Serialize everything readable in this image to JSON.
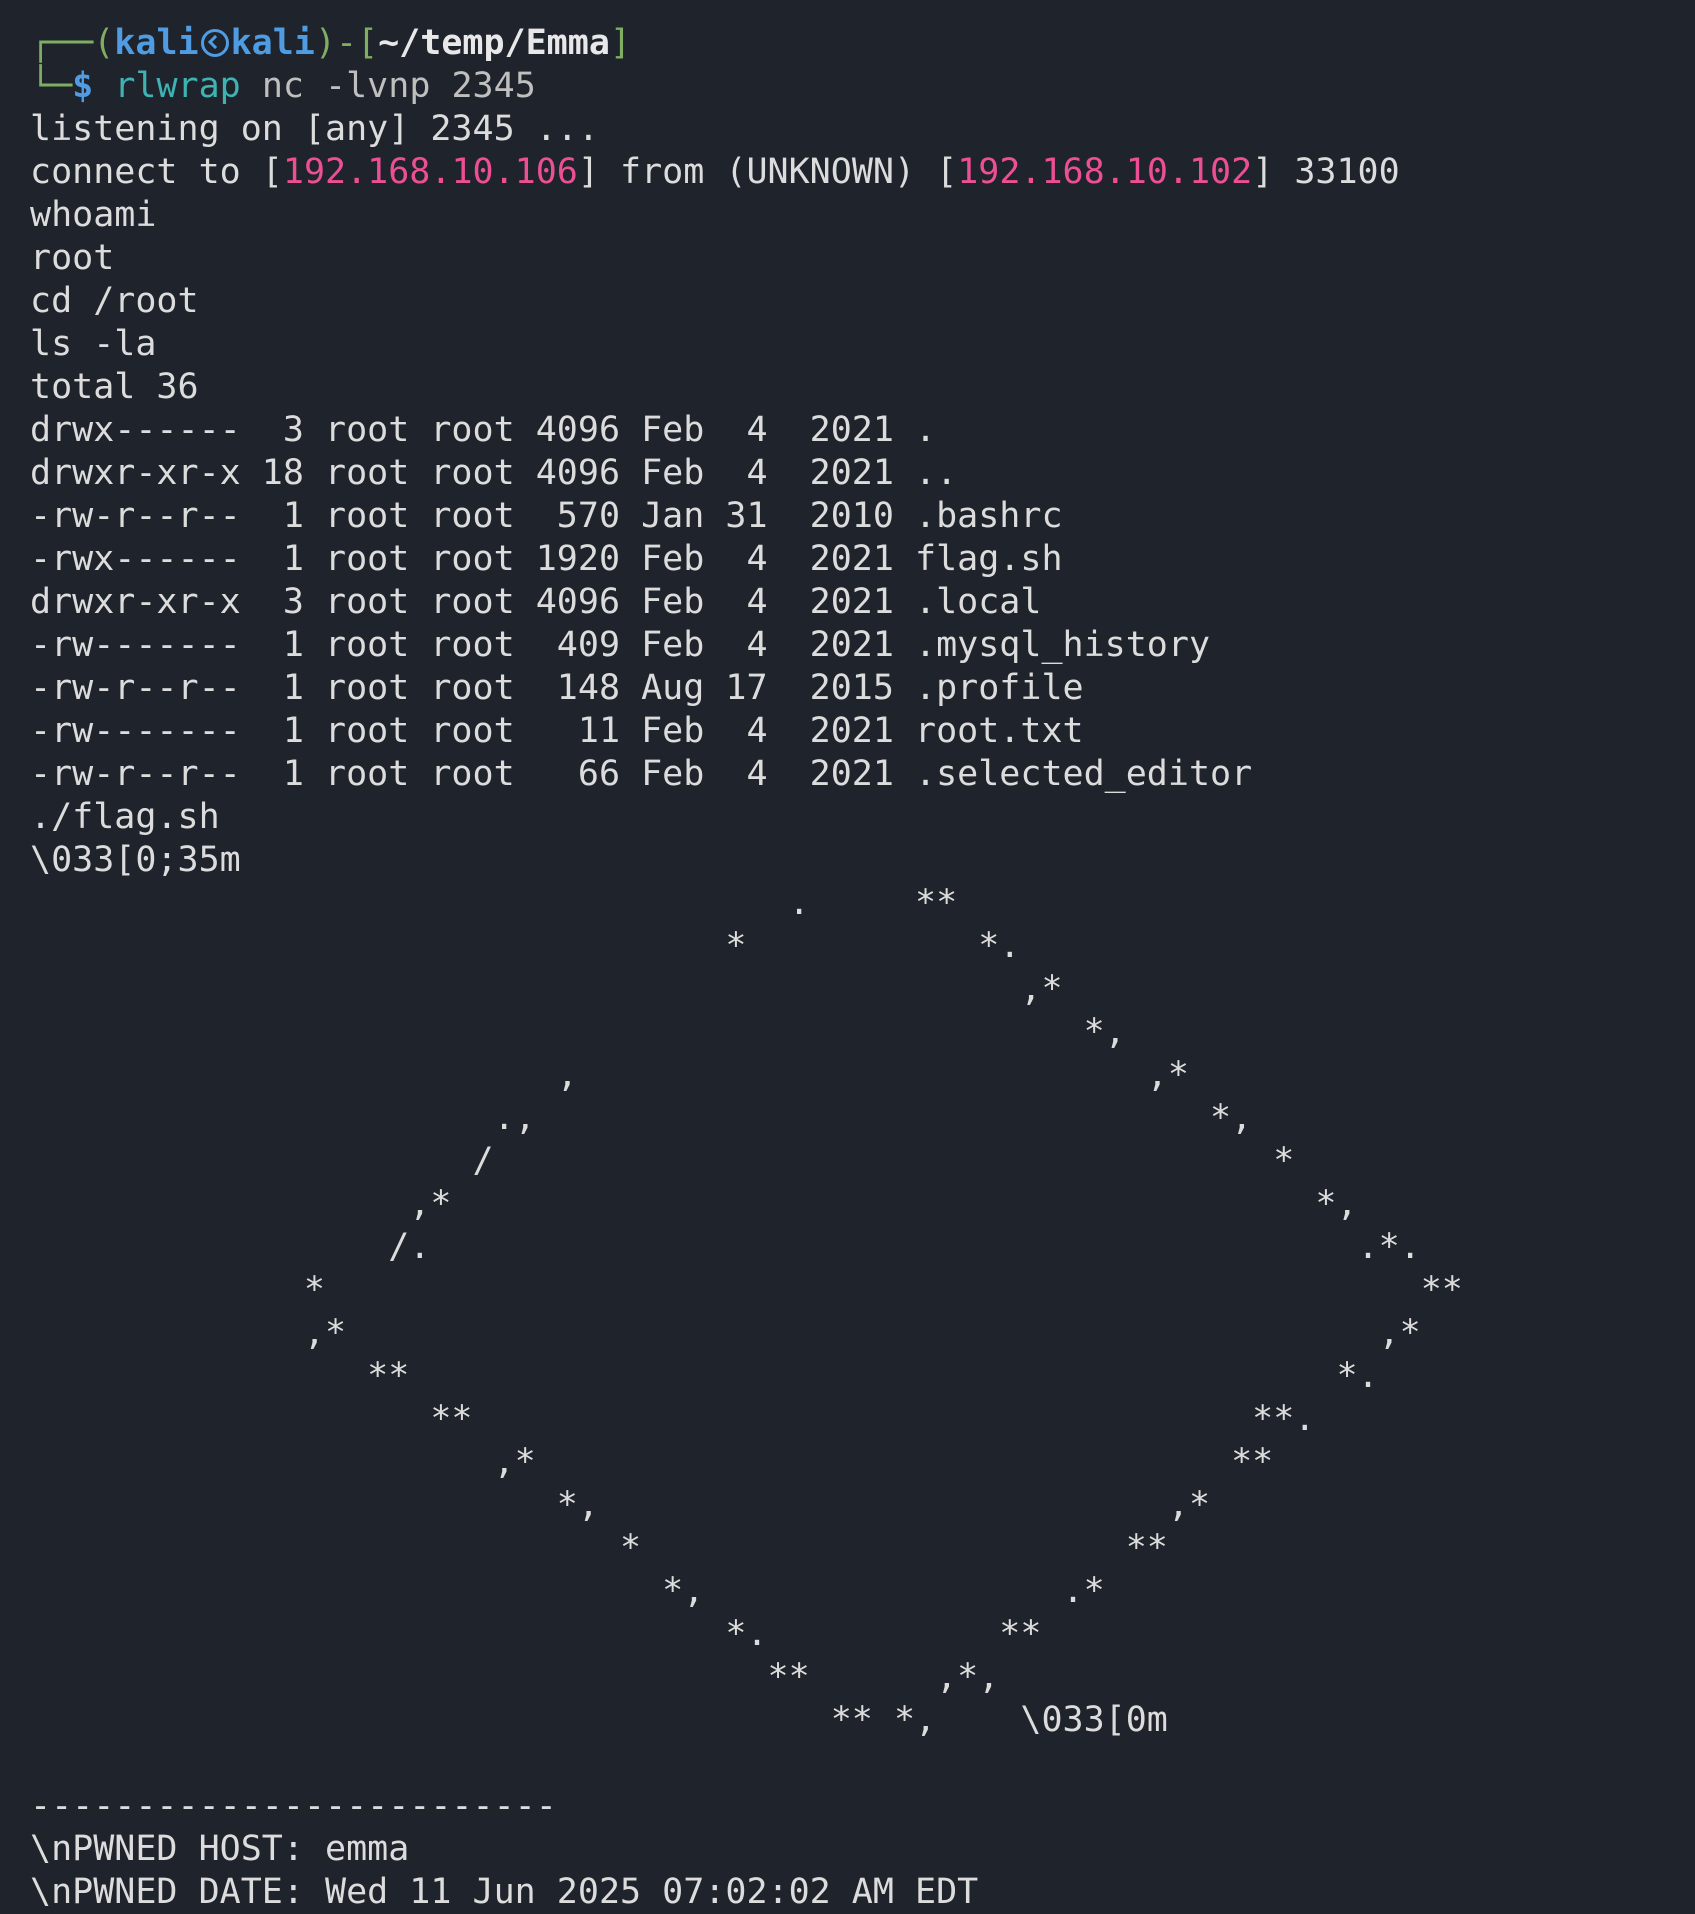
{
  "prompt": {
    "corner_top": "┌──",
    "open_paren": "(",
    "user": "kali",
    "host": "kali",
    "close_bracket_dash": ")-[",
    "path": "~/temp/Emma",
    "close_bracket": "]",
    "corner_bottom": "└─",
    "dollar": "$",
    "command": "rlwrap",
    "args": "nc -lvnp 2345"
  },
  "listening": "listening on [any] 2345 ...",
  "connect": {
    "prefix": "connect to [",
    "local_ip": "192.168.10.106",
    "mid": "] from (UNKNOWN) [",
    "remote_ip": "192.168.10.102",
    "suffix": "] 33100"
  },
  "output_lines": [
    "whoami",
    "root",
    "cd /root",
    "ls -la",
    "total 36",
    "drwx------  3 root root 4096 Feb  4  2021 .",
    "drwxr-xr-x 18 root root 4096 Feb  4  2021 ..",
    "-rw-r--r--  1 root root  570 Jan 31  2010 .bashrc",
    "-rwx------  1 root root 1920 Feb  4  2021 flag.sh",
    "drwxr-xr-x  3 root root 4096 Feb  4  2021 .local",
    "-rw-------  1 root root  409 Feb  4  2021 .mysql_history",
    "-rw-r--r--  1 root root  148 Aug 17  2015 .profile",
    "-rw-------  1 root root   11 Feb  4  2021 root.txt",
    "-rw-r--r--  1 root root   66 Feb  4  2021 .selected_editor",
    "./flag.sh",
    "\\033[0;35m",
    "                                    .     **",
    "                                 *           *.",
    "                                               ,*",
    "                                                  *,",
    "                         ,                           ,*",
    "                      .,                                *,",
    "                     /                                     *",
    "                  ,*                                         *,",
    "                 /.                                            .*.",
    "             *                                                    **",
    "             ,*                                                 ,*",
    "                **                                            *.",
    "                   **                                     **.",
    "                      ,*                                 **",
    "                         *,                           ,*",
    "                            *                       **",
    "                              *,                 .*",
    "                                 *.           **",
    "                                   **      ,*,",
    "                                      ** *,    \\033[0m",
    "",
    "-------------------------",
    "\\nPWNED HOST: emma",
    "\\nPWNED DATE: Wed 11 Jun 2025 07:02:02 AM EDT"
  ]
}
